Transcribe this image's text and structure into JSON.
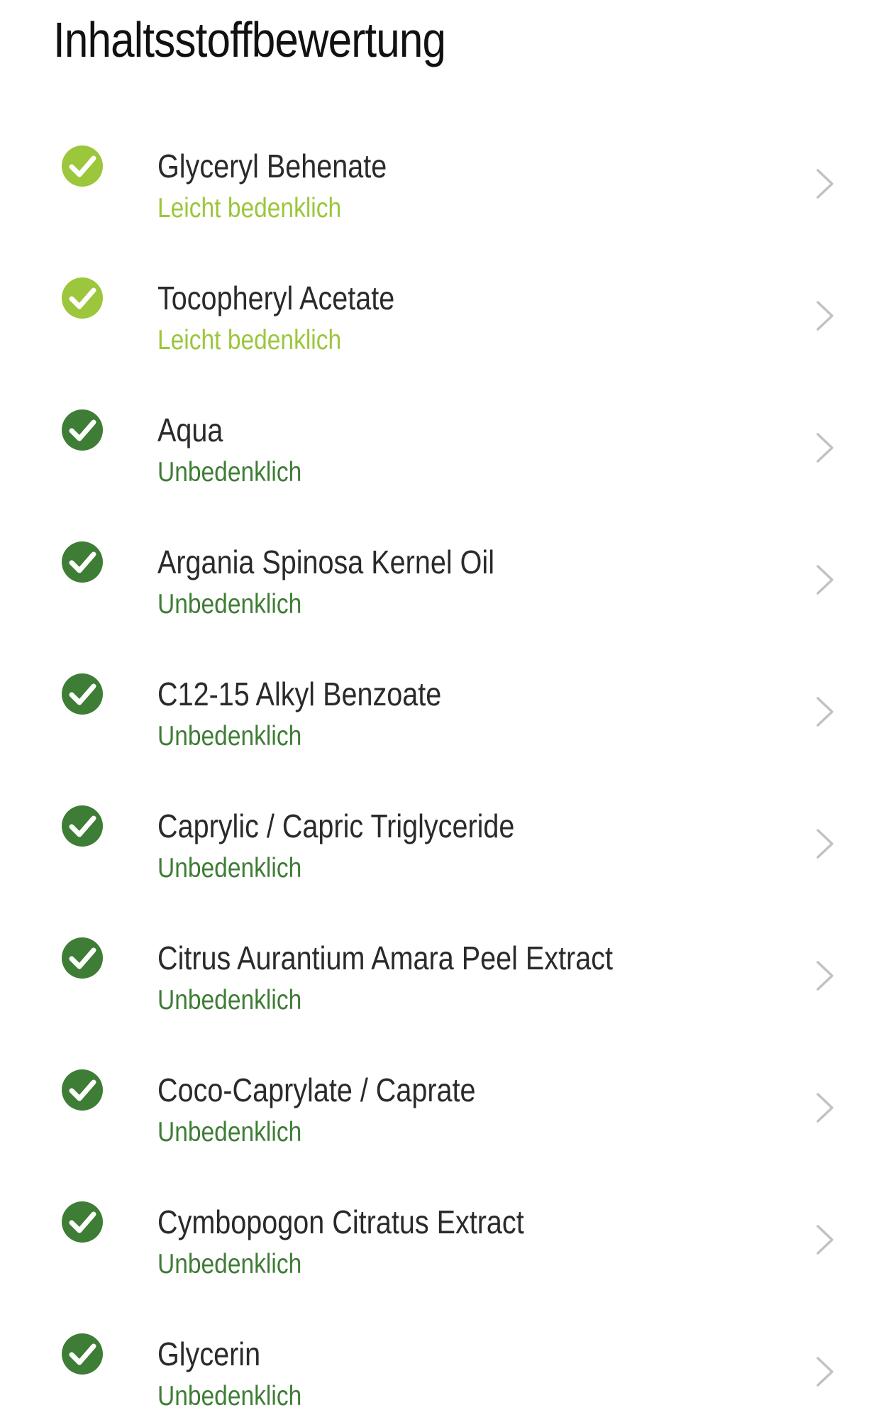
{
  "header": {
    "title": "Inhaltsstoffbewertung"
  },
  "colors": {
    "light_concern": "#9cc63b",
    "harmless": "#3e7d35",
    "chevron": "#c2c2c2"
  },
  "ingredients": [
    {
      "name": "Glyceryl Behenate",
      "rating": "Leicht bedenklich",
      "level": "light",
      "icon": "check-circle-icon"
    },
    {
      "name": "Tocopheryl Acetate",
      "rating": "Leicht bedenklich",
      "level": "light",
      "icon": "check-circle-icon"
    },
    {
      "name": "Aqua",
      "rating": "Unbedenklich",
      "level": "harmless",
      "icon": "check-circle-icon"
    },
    {
      "name": "Argania Spinosa Kernel Oil",
      "rating": "Unbedenklich",
      "level": "harmless",
      "icon": "check-circle-icon"
    },
    {
      "name": "C12-15 Alkyl Benzoate",
      "rating": "Unbedenklich",
      "level": "harmless",
      "icon": "check-circle-icon"
    },
    {
      "name": "Caprylic / Capric Triglyceride",
      "rating": "Unbedenklich",
      "level": "harmless",
      "icon": "check-circle-icon"
    },
    {
      "name": "Citrus Aurantium Amara Peel Extract",
      "rating": "Unbedenklich",
      "level": "harmless",
      "icon": "check-circle-icon"
    },
    {
      "name": "Coco-Caprylate / Caprate",
      "rating": "Unbedenklich",
      "level": "harmless",
      "icon": "check-circle-icon"
    },
    {
      "name": "Cymbopogon Citratus Extract",
      "rating": "Unbedenklich",
      "level": "harmless",
      "icon": "check-circle-icon"
    },
    {
      "name": "Glycerin",
      "rating": "Unbedenklich",
      "level": "harmless",
      "icon": "check-circle-icon"
    }
  ]
}
